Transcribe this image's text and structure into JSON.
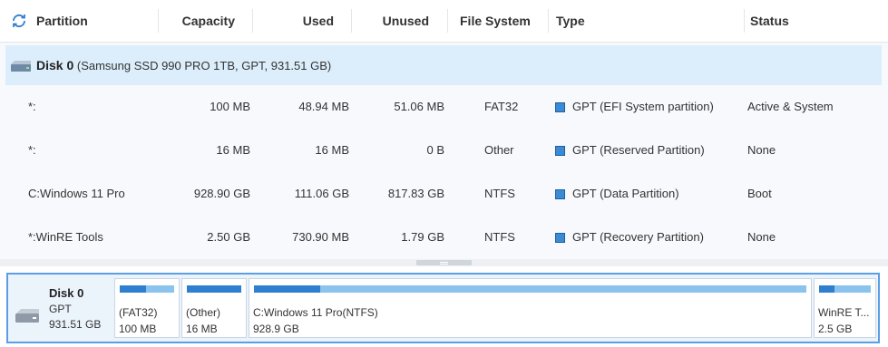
{
  "header": {
    "columns": [
      "Partition",
      "Capacity",
      "Used",
      "Unused",
      "File System",
      "Type",
      "Status"
    ]
  },
  "disk": {
    "name": "Disk 0",
    "detail": "(Samsung SSD 990 PRO 1TB, GPT, 931.51 GB)"
  },
  "partitions": [
    {
      "partition": "*:",
      "capacity": "100 MB",
      "used": "48.94 MB",
      "unused": "51.06 MB",
      "fs": "FAT32",
      "type": "GPT (EFI System partition)",
      "status": "Active & System"
    },
    {
      "partition": "*:",
      "capacity": "16 MB",
      "used": "16 MB",
      "unused": "0 B",
      "fs": "Other",
      "type": "GPT (Reserved Partition)",
      "status": "None"
    },
    {
      "partition": "C:Windows 11 Pro",
      "capacity": "928.90 GB",
      "used": "111.06 GB",
      "unused": "817.83 GB",
      "fs": "NTFS",
      "type": "GPT (Data Partition)",
      "status": "Boot"
    },
    {
      "partition": "*:WinRE Tools",
      "capacity": "2.50 GB",
      "used": "730.90 MB",
      "unused": "1.79 GB",
      "fs": "NTFS",
      "type": "GPT (Recovery Partition)",
      "status": "None"
    }
  ],
  "disk_map": {
    "name": "Disk 0",
    "style": "GPT",
    "size": "931.51 GB",
    "blocks": [
      {
        "label": "(FAT32)",
        "size": "100 MB",
        "used_fraction": 0.49
      },
      {
        "label": "(Other)",
        "size": "16 MB",
        "used_fraction": 1.0
      },
      {
        "label": "C:Windows 11 Pro(NTFS)",
        "size": "928.9 GB",
        "used_fraction": 0.12
      },
      {
        "label": "WinRE T...",
        "size": "2.5 GB",
        "used_fraction": 0.29
      }
    ]
  },
  "colors": {
    "selected_row": "#dceefb",
    "used_bar": "#2f7fd1",
    "free_bar": "#8ac4ee",
    "type_marker": "#3a8ad6",
    "map_border": "#5b9ee6"
  }
}
